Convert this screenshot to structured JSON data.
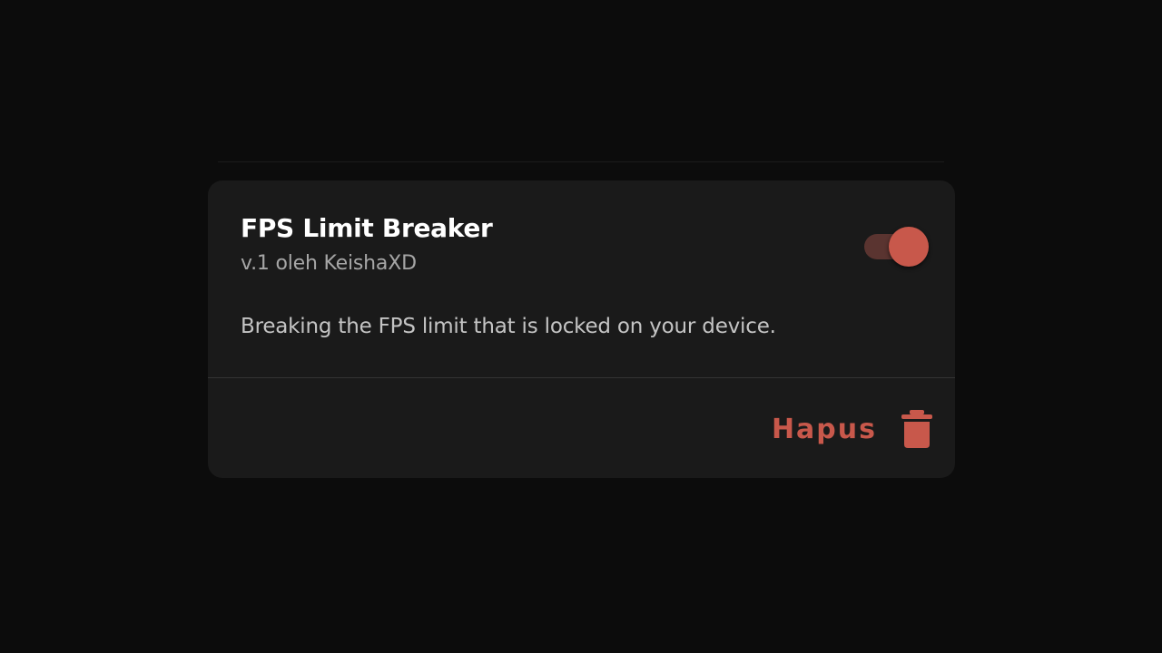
{
  "module": {
    "title": "FPS Limit Breaker",
    "meta": "v.1 oleh KeishaXD",
    "description": "Breaking the FPS limit that is locked on your device.",
    "enabled": true
  },
  "actions": {
    "remove_label": "Hapus",
    "remove_icon": "trash-icon"
  },
  "colors": {
    "accent": "#c8584b",
    "accent_track": "#5a3430",
    "card_background": "#1a1a1a",
    "page_background": "#0c0c0c"
  }
}
